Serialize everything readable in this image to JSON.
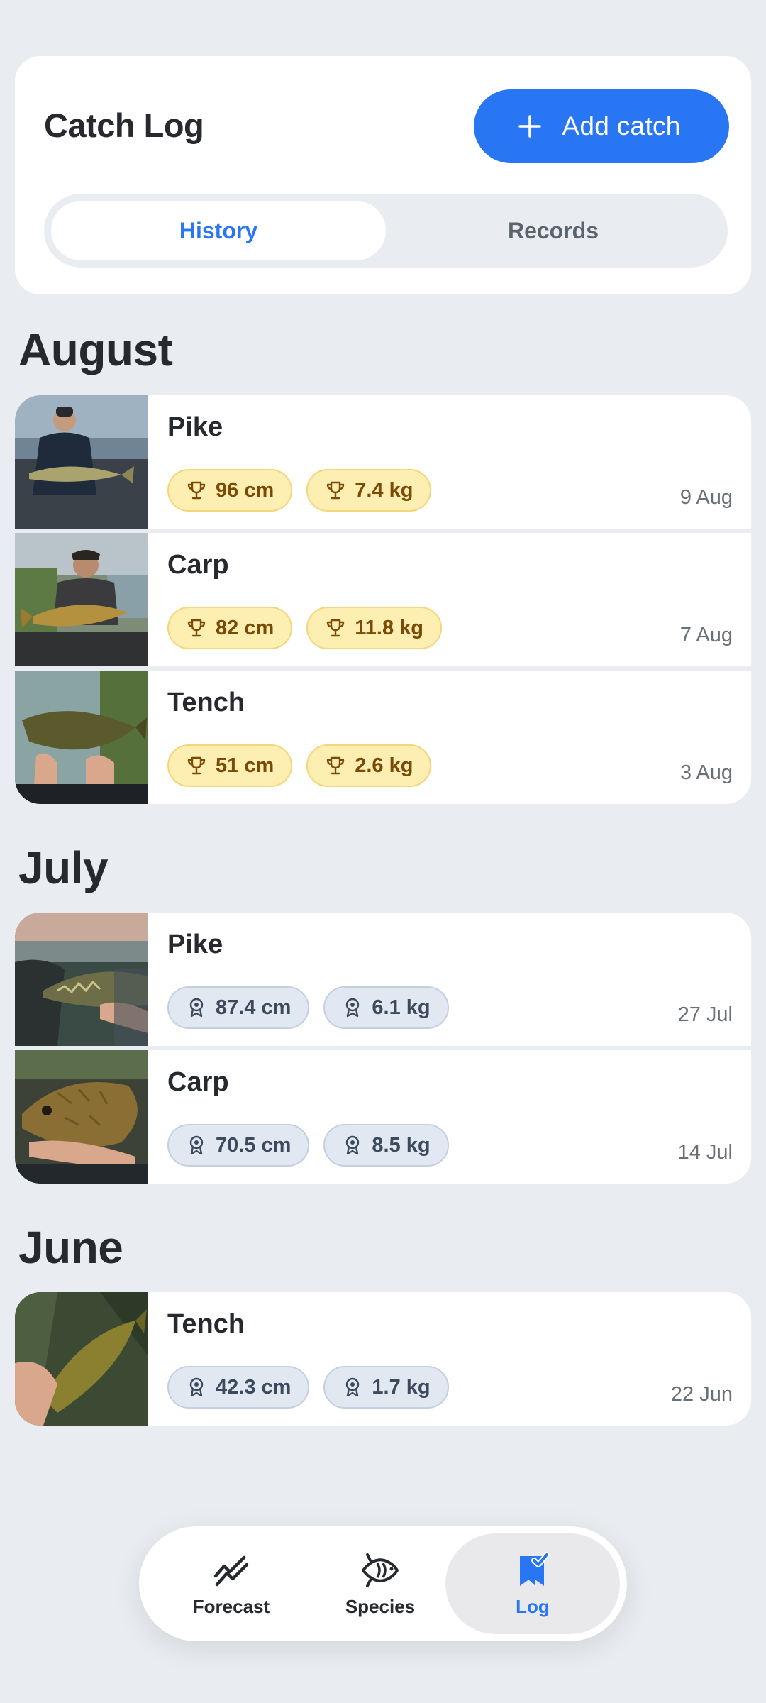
{
  "header": {
    "title": "Catch Log",
    "add_button": "Add catch",
    "tabs": [
      {
        "label": "History",
        "active": true
      },
      {
        "label": "Records",
        "active": false
      }
    ]
  },
  "sections": [
    {
      "month": "August",
      "catches": [
        {
          "species": "Pike",
          "length": "96 cm",
          "weight": "7.4 kg",
          "date": "9 Aug",
          "badge_style": "trophy"
        },
        {
          "species": "Carp",
          "length": "82 cm",
          "weight": "11.8 kg",
          "date": "7 Aug",
          "badge_style": "trophy"
        },
        {
          "species": "Tench",
          "length": "51 cm",
          "weight": "2.6 kg",
          "date": "3 Aug",
          "badge_style": "trophy"
        }
      ]
    },
    {
      "month": "July",
      "catches": [
        {
          "species": "Pike",
          "length": "87.4 cm",
          "weight": "6.1 kg",
          "date": "27 Jul",
          "badge_style": "medal"
        },
        {
          "species": "Carp",
          "length": "70.5 cm",
          "weight": "8.5 kg",
          "date": "14 Jul",
          "badge_style": "medal"
        }
      ]
    },
    {
      "month": "June",
      "catches": [
        {
          "species": "Tench",
          "length": "42.3 cm",
          "weight": "1.7 kg",
          "date": "22 Jun",
          "badge_style": "medal"
        }
      ]
    }
  ],
  "nav": [
    {
      "label": "Forecast",
      "icon": "forecast-chart-icon",
      "active": false
    },
    {
      "label": "Species",
      "icon": "fish-icon",
      "active": false
    },
    {
      "label": "Log",
      "icon": "bookmark-check-icon",
      "active": true
    }
  ],
  "colors": {
    "accent": "#2876f4",
    "background": "#e9edf1",
    "record_badge_bg": "#fdeeb2",
    "record_badge_text": "#7a4a06",
    "badge_bg": "#e1e8f2",
    "badge_text": "#3c4a5c"
  }
}
